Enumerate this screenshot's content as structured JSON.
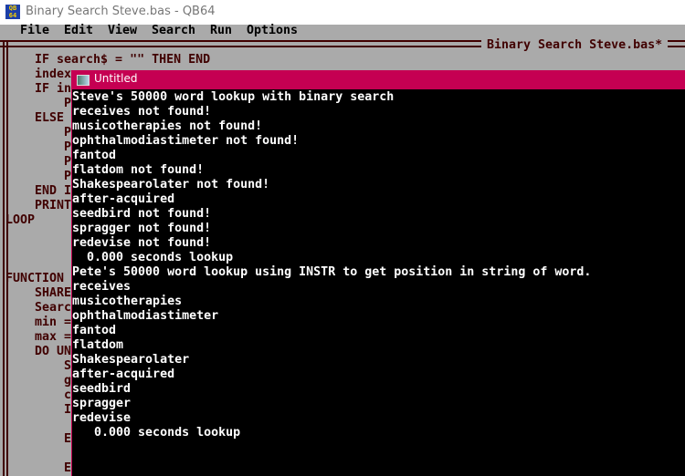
{
  "window": {
    "title": "Binary Search Steve.bas - QB64",
    "icon": "qb64-icon",
    "icon_text": "QB64"
  },
  "menu": [
    "File",
    "Edit",
    "View",
    "Search",
    "Run",
    "Options"
  ],
  "editor": {
    "title": "Binary Search Steve.bas*",
    "lines": [
      {
        "row": 0,
        "col": 4,
        "text": "IF search$ = \"\" THEN END"
      },
      {
        "row": 1,
        "col": 4,
        "text": "index"
      },
      {
        "row": 2,
        "col": 4,
        "text": "IF in"
      },
      {
        "row": 3,
        "col": 8,
        "text": "P"
      },
      {
        "row": 4,
        "col": 4,
        "text": "ELSE"
      },
      {
        "row": 5,
        "col": 8,
        "text": "P"
      },
      {
        "row": 6,
        "col": 8,
        "text": "P"
      },
      {
        "row": 7,
        "col": 8,
        "text": "P"
      },
      {
        "row": 8,
        "col": 8,
        "text": "P"
      },
      {
        "row": 9,
        "col": 4,
        "text": "END I"
      },
      {
        "row": 10,
        "col": 4,
        "text": "PRINT"
      },
      {
        "row": 11,
        "col": 0,
        "text": "LOOP"
      },
      {
        "row": 15,
        "col": 0,
        "text": "FUNCTION"
      },
      {
        "row": 16,
        "col": 4,
        "text": "SHARE"
      },
      {
        "row": 17,
        "col": 4,
        "text": "Searc"
      },
      {
        "row": 18,
        "col": 4,
        "text": "min ="
      },
      {
        "row": 19,
        "col": 4,
        "text": "max ="
      },
      {
        "row": 20,
        "col": 4,
        "text": "DO UN"
      },
      {
        "row": 21,
        "col": 8,
        "text": "S"
      },
      {
        "row": 22,
        "col": 8,
        "text": "g"
      },
      {
        "row": 23,
        "col": 8,
        "text": "c"
      },
      {
        "row": 24,
        "col": 8,
        "text": "I"
      },
      {
        "row": 26,
        "col": 8,
        "text": "E"
      },
      {
        "row": 28,
        "col": 8,
        "text": "E"
      }
    ]
  },
  "output_window": {
    "title": "Untitled",
    "lines": [
      "Steve's 50000 word lookup with binary search",
      "receives not found!",
      "musicotherapies not found!",
      "ophthalmodiastimeter not found!",
      "fantod",
      "flatdom not found!",
      "Shakespearolater not found!",
      "after-acquired",
      "seedbird not found!",
      "spragger not found!",
      "redevise not found!",
      "  0.000 seconds lookup",
      "Pete's 50000 word lookup using INSTR to get position in string of word.",
      "receives",
      "musicotherapies",
      "ophthalmodiastimeter",
      "fantod",
      "flatdom",
      "Shakespearolater",
      "after-acquired",
      "seedbird",
      "spragger",
      "redevise",
      "   0.000 seconds lookup"
    ]
  },
  "colors": {
    "editor_bg": "#aaaaaa",
    "editor_text": "#400000",
    "output_title_bg": "#c50052",
    "output_bg": "#000000",
    "output_text": "#ffffff"
  }
}
